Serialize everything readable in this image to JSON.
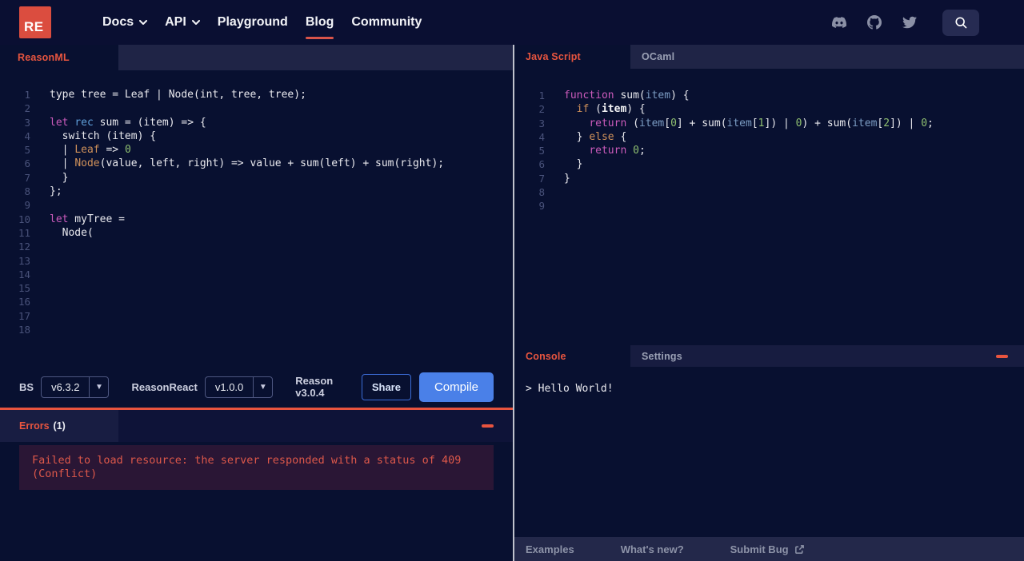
{
  "header": {
    "logo_text": "RE",
    "nav": [
      {
        "label": "Docs",
        "chevron": true,
        "active": false
      },
      {
        "label": "API",
        "chevron": true,
        "active": false
      },
      {
        "label": "Playground",
        "chevron": false,
        "active": false
      },
      {
        "label": "Blog",
        "chevron": false,
        "active": true
      },
      {
        "label": "Community",
        "chevron": false,
        "active": false
      }
    ],
    "social_icons": [
      "discord-icon",
      "github-icon",
      "twitter-icon"
    ],
    "search_icon": "search-icon"
  },
  "colors": {
    "brand_red": "#db4d3f",
    "accent_red": "#e8543f",
    "compile_blue": "#4a80e8",
    "error_bg": "#2a1635",
    "error_text": "#dd584a"
  },
  "left_panel": {
    "tab_label": "ReasonML",
    "editor_lines": [
      [
        [
          "plain",
          "type tree = Leaf | Node(int, tree, tree);"
        ]
      ],
      [],
      [
        [
          "kw1",
          "let"
        ],
        [
          "plain",
          " "
        ],
        [
          "kw2",
          "rec"
        ],
        [
          "plain",
          " sum = (item) => {"
        ]
      ],
      [
        [
          "plain",
          "  switch (item) {"
        ]
      ],
      [
        [
          "plain",
          "  | "
        ],
        [
          "orange",
          "Leaf"
        ],
        [
          "plain",
          " => "
        ],
        [
          "num",
          "0"
        ]
      ],
      [
        [
          "plain",
          "  | "
        ],
        [
          "orange",
          "Node"
        ],
        [
          "plain",
          "(value, left, right) => value + sum(left) + sum(right);"
        ]
      ],
      [
        [
          "plain",
          "  }"
        ]
      ],
      [
        [
          "plain",
          "};"
        ]
      ],
      [],
      [
        [
          "kw1",
          "let"
        ],
        [
          "plain",
          " myTree ="
        ]
      ],
      [
        [
          "plain",
          "  Node("
        ]
      ],
      [],
      [],
      [],
      [],
      [],
      [],
      []
    ],
    "toolbar": {
      "bs_label": "BS",
      "bs_version": "v6.3.2",
      "reasonreact_label": "ReasonReact",
      "reasonreact_version": "v1.0.0",
      "reason_version": "Reason v3.0.4",
      "share_label": "Share",
      "compile_label": "Compile",
      "caret": "▼"
    },
    "errors": {
      "title": "Errors",
      "count": "(1)",
      "message": "Failed to load resource: the server responded with a status of 409 (Conflict)"
    }
  },
  "right_panel": {
    "tabs": [
      {
        "label": "Java Script",
        "active": true
      },
      {
        "label": "OCaml",
        "active": false
      }
    ],
    "editor_lines": [
      [
        [
          "kw1",
          "function"
        ],
        [
          "plain",
          " sum("
        ],
        [
          "param",
          "item"
        ],
        [
          "plain",
          ") {"
        ]
      ],
      [
        [
          "plain",
          "  "
        ],
        [
          "orange",
          "if"
        ],
        [
          "plain",
          " ("
        ],
        [
          "boldw",
          "item"
        ],
        [
          "plain",
          ") {"
        ]
      ],
      [
        [
          "plain",
          "    "
        ],
        [
          "kw1",
          "return"
        ],
        [
          "plain",
          " ("
        ],
        [
          "param",
          "item"
        ],
        [
          "plain",
          "["
        ],
        [
          "num",
          "0"
        ],
        [
          "plain",
          "] + sum("
        ],
        [
          "param",
          "item"
        ],
        [
          "plain",
          "["
        ],
        [
          "num",
          "1"
        ],
        [
          "plain",
          "]) | "
        ],
        [
          "num",
          "0"
        ],
        [
          "plain",
          ") + sum("
        ],
        [
          "param",
          "item"
        ],
        [
          "plain",
          "["
        ],
        [
          "num",
          "2"
        ],
        [
          "plain",
          "]) | "
        ],
        [
          "num",
          "0"
        ],
        [
          "plain",
          ";"
        ]
      ],
      [
        [
          "plain",
          "  } "
        ],
        [
          "orange",
          "else"
        ],
        [
          "plain",
          " {"
        ]
      ],
      [
        [
          "plain",
          "    "
        ],
        [
          "kw1",
          "return"
        ],
        [
          "plain",
          " "
        ],
        [
          "num",
          "0"
        ],
        [
          "plain",
          ";"
        ]
      ],
      [
        [
          "plain",
          "  }"
        ]
      ],
      [
        [
          "plain",
          "}"
        ]
      ],
      [],
      []
    ],
    "console": {
      "tab_console": "Console",
      "tab_settings": "Settings",
      "output": "> Hello World!"
    },
    "footer_links": [
      "Examples",
      "What's new?",
      "Submit Bug"
    ]
  }
}
